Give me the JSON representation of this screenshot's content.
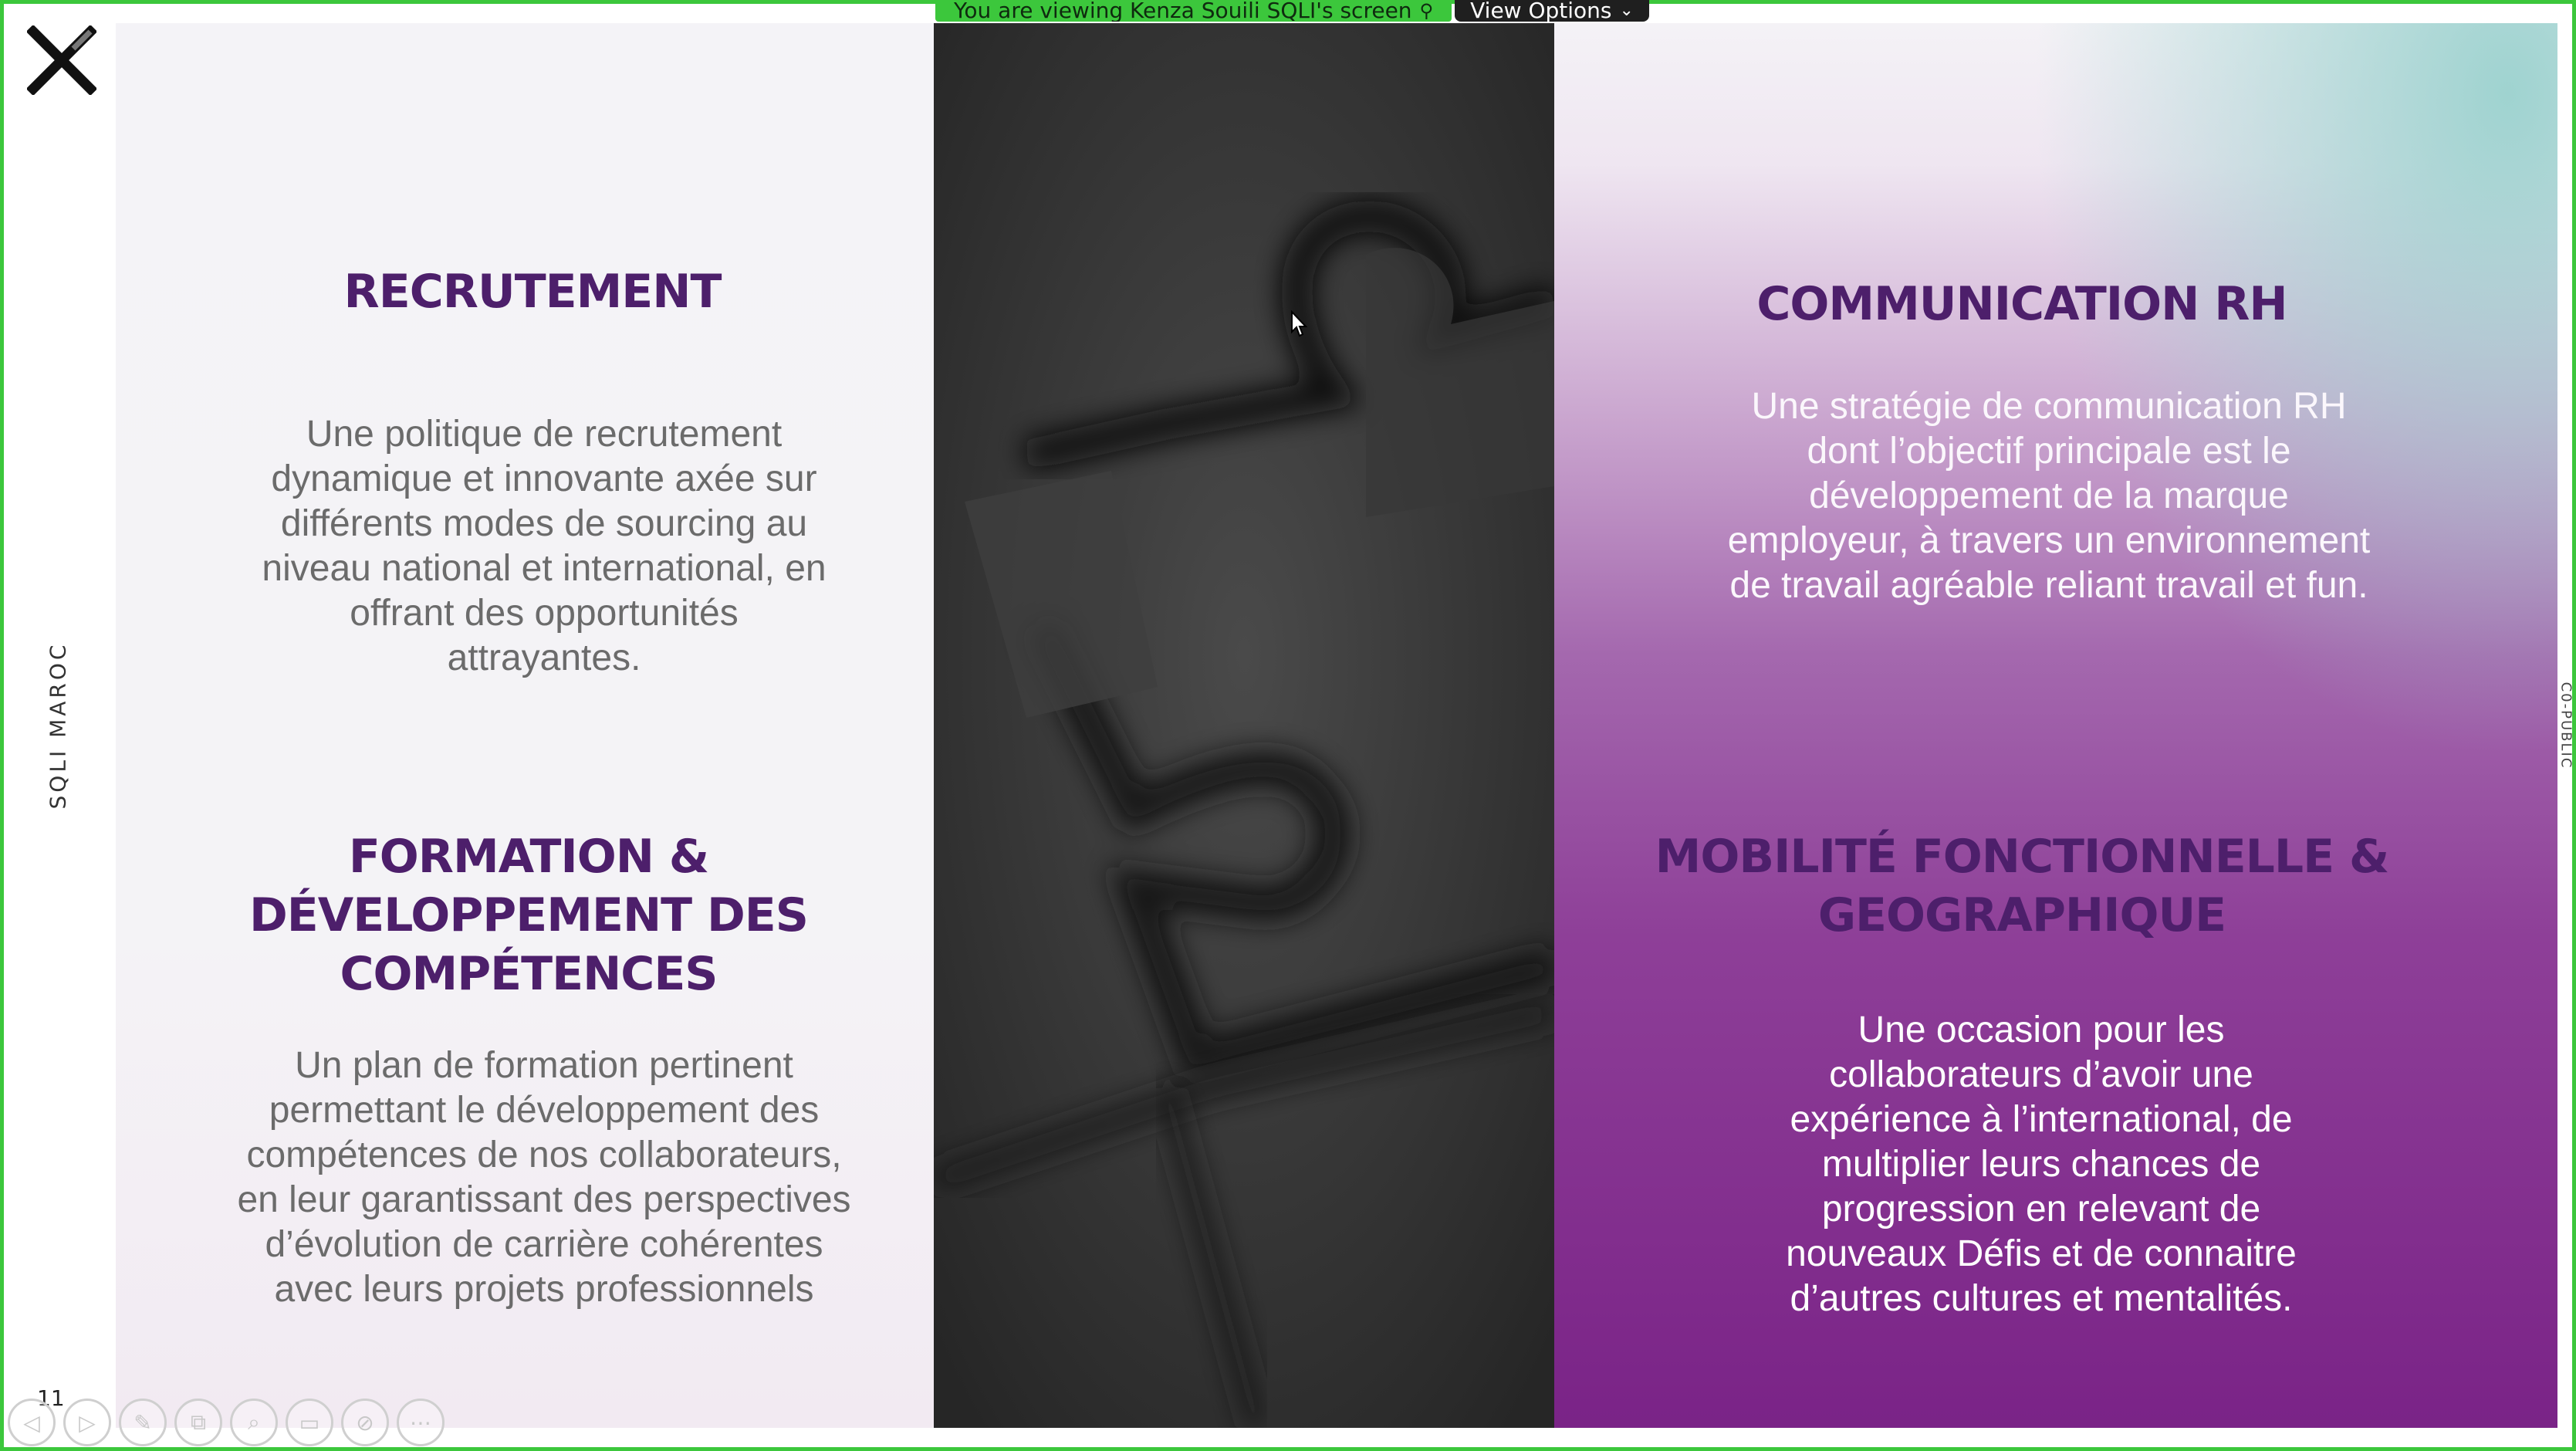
{
  "share_banner": {
    "status_text": "You are viewing Kenza Souili SQLI's screen",
    "view_options_label": "View Options"
  },
  "slide": {
    "side_label": "SQLI MAROC",
    "page_number": "11",
    "classification_label": "C0-PUBLIC",
    "sections": {
      "recrutement": {
        "title": "RECRUTEMENT",
        "lines": [
          "Une politique de recrutement",
          "dynamique et innovante axée sur",
          "différents modes de sourcing au",
          "niveau national et international, en",
          "offrant des opportunités",
          "attrayantes."
        ]
      },
      "formation": {
        "title_lines": [
          "FORMATION &",
          "DÉVELOPPEMENT DES",
          "COMPÉTENCES"
        ],
        "lines": [
          "Un plan de formation pertinent",
          "permettant le développement des",
          "compétences de nos collaborateurs,",
          "en leur garantissant des perspectives",
          "d’évolution de carrière cohérentes",
          "avec leurs projets professionnels"
        ]
      },
      "communication": {
        "title": "COMMUNICATION RH",
        "lines": [
          "Une stratégie de communication RH",
          "dont l’objectif principale est le",
          "développement de la marque",
          "employeur, à travers un environnement",
          "de travail agréable reliant travail et fun."
        ]
      },
      "mobilite": {
        "title_lines": [
          "MOBILITÉ FONCTIONNELLE &",
          "GEOGRAPHIQUE"
        ],
        "lines": [
          "Une occasion pour les",
          "collaborateurs d’avoir une",
          "expérience à l’international, de",
          "multiplier leurs chances de",
          "progression en relevant de",
          "nouveaux Défis et de connaitre",
          "d’autres cultures et mentalités."
        ]
      }
    }
  },
  "toolbar": {
    "buttons": [
      {
        "icon": "previous-icon",
        "glyph": "◁"
      },
      {
        "icon": "next-icon",
        "glyph": "▷"
      },
      {
        "icon": "pen-icon",
        "glyph": "✎"
      },
      {
        "icon": "slides-icon",
        "glyph": "⧉"
      },
      {
        "icon": "zoom-icon",
        "glyph": "⌕"
      },
      {
        "icon": "subtitles-icon",
        "glyph": "▭"
      },
      {
        "icon": "camera-off-icon",
        "glyph": "⊘"
      },
      {
        "icon": "more-icon",
        "glyph": "⋯"
      }
    ]
  },
  "colors": {
    "share_green": "#3cc73c",
    "heading_purple": "#4d1f6b",
    "body_grey": "#6b6b6b"
  }
}
